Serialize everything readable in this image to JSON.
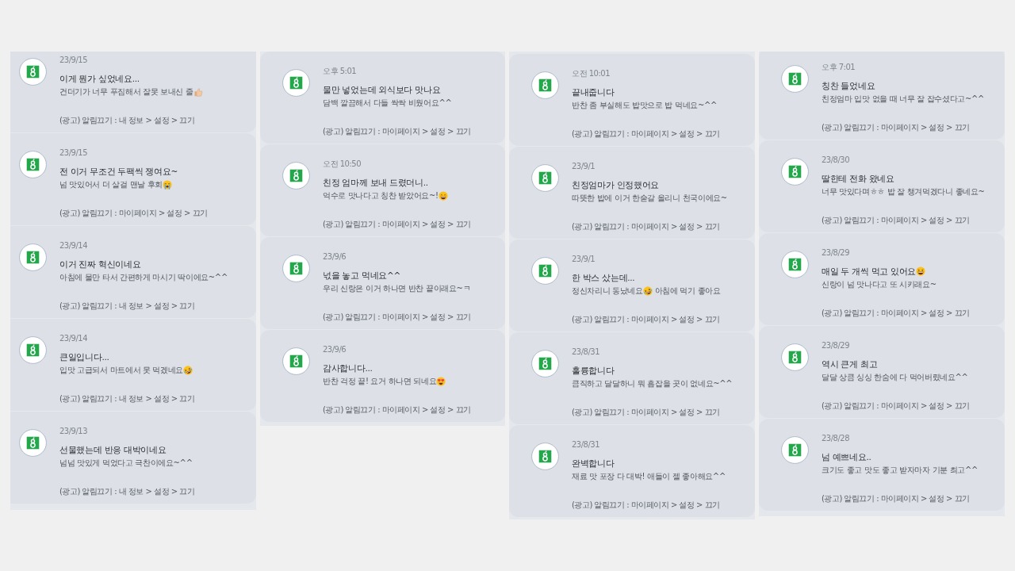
{
  "columns": [
    {
      "notifications": [
        {
          "time": "23/9/15",
          "title": [
            {
              "kind": "text",
              "text": "이게 뭔가 싶었네요..."
            }
          ],
          "body": [
            {
              "kind": "text",
              "text": "건더기가 너무 푸짐해서 잘못 보내신 줄"
            },
            {
              "kind": "thumbs-up"
            }
          ],
          "footer": "(광고) 알림끄기 : 내 정보 > 설정 > 끄기"
        },
        {
          "time": "23/9/15",
          "title": [
            {
              "kind": "text",
              "text": "전 이거 무조건 두팩씩 쟁여요~"
            }
          ],
          "body": [
            {
              "kind": "text",
              "text": "넘 맛있어서 더 살걸 맨날 후회"
            },
            {
              "kind": "crying"
            }
          ],
          "footer": "(광고) 알림끄기 : 마이페이지 > 설정 > 끄기"
        },
        {
          "time": "23/9/14",
          "title": [
            {
              "kind": "text",
              "text": "이거 진짜 혁신이네요"
            }
          ],
          "body": [
            {
              "kind": "text",
              "text": "아침에 물만 타서 간편하게 마시기 딱이에요~^^"
            }
          ],
          "footer": "(광고) 알림끄기 : 내 정보 > 설정 > 끄기"
        },
        {
          "time": "23/9/14",
          "title": [
            {
              "kind": "text",
              "text": "큰일입니다..."
            }
          ],
          "body": [
            {
              "kind": "text",
              "text": "입맛 고급되서 마트에서 못 먹겠네요"
            },
            {
              "kind": "rofl"
            }
          ],
          "footer": "(광고) 알림끄기 : 내 정보 > 설정 > 끄기"
        },
        {
          "time": "23/9/13",
          "title": [
            {
              "kind": "text",
              "text": "선물했는데 반응 대박이네요"
            }
          ],
          "body": [
            {
              "kind": "text",
              "text": "넘넘 맛있게 먹었다고 극찬이에요~^^"
            }
          ],
          "footer": "(광고) 알림끄기 : 내 정보 > 설정 > 끄기"
        }
      ]
    },
    {
      "notifications": [
        {
          "time": "오후 5:01",
          "title": [
            {
              "kind": "text",
              "text": "물만 넣었는데 외식보다 맛나요"
            }
          ],
          "body": [
            {
              "kind": "text",
              "text": "담백 깔끔해서 다들 싹싹 비웠어요^^"
            }
          ],
          "footer": "(광고) 알림끄기 : 마이페이지 > 설정 > 끄기"
        },
        {
          "time": "오전 10:50",
          "title": [
            {
              "kind": "text",
              "text": "친정 엄마께 보내 드렸더니.."
            }
          ],
          "body": [
            {
              "kind": "text",
              "text": "억수로 맛나다고 칭찬 받았어요~!"
            },
            {
              "kind": "grin"
            }
          ],
          "footer": "(광고) 알림끄기 : 마이페이지 > 설정 > 끄기"
        },
        {
          "time": "23/9/6",
          "title": [
            {
              "kind": "text",
              "text": "넋을 놓고 먹네요^^"
            }
          ],
          "body": [
            {
              "kind": "text",
              "text": "우리 신랑은 이거 하나면 반찬 끝이래요~ㅋ"
            }
          ],
          "footer": "(광고) 알림끄기 : 마이페이지 > 설정 > 끄기"
        },
        {
          "time": "23/9/6",
          "title": [
            {
              "kind": "text",
              "text": "감사합니다..."
            }
          ],
          "body": [
            {
              "kind": "text",
              "text": "반찬 걱정 끝! 요거 하나면 되네요"
            },
            {
              "kind": "heart-eyes"
            }
          ],
          "footer": "(광고) 알림끄기 : 마이페이지 > 설정 > 끄기"
        }
      ]
    },
    {
      "notifications": [
        {
          "time": "오전 10:01",
          "title": [
            {
              "kind": "text",
              "text": "끝내줍니다"
            }
          ],
          "body": [
            {
              "kind": "text",
              "text": "반찬 좀 부실해도 밥맛으로 밥 먹네요~^^"
            }
          ],
          "footer": "(광고) 알림끄기 : 마이페이지 > 설정 > 끄기"
        },
        {
          "time": "23/9/1",
          "title": [
            {
              "kind": "text",
              "text": "친정엄마가 인정했어요"
            }
          ],
          "body": [
            {
              "kind": "text",
              "text": "따뜻한 밥에 이거 한숟갈 올리니 천국이에요~"
            }
          ],
          "footer": "(광고) 알림끄기 : 마이페이지 > 설정 > 끄기"
        },
        {
          "time": "23/9/1",
          "title": [
            {
              "kind": "text",
              "text": "한 박스 샀는데..."
            }
          ],
          "body": [
            {
              "kind": "text",
              "text": "정신차리니 동났네요"
            },
            {
              "kind": "rofl"
            },
            {
              "kind": "text",
              "text": "아침에 먹기 좋아요"
            }
          ],
          "footer": "(광고) 알림끄기 : 마이페이지 > 설정 > 끄기"
        },
        {
          "time": "23/8/31",
          "title": [
            {
              "kind": "text",
              "text": "훌륭합니다"
            }
          ],
          "body": [
            {
              "kind": "text",
              "text": "큼직하고 달달하니 뭐 흠잡을 곳이 없네요~^^"
            }
          ],
          "footer": "(광고) 알림끄기 : 마이페이지 > 설정 > 끄기"
        },
        {
          "time": "23/8/31",
          "title": [
            {
              "kind": "text",
              "text": "완벽합니다"
            }
          ],
          "body": [
            {
              "kind": "text",
              "text": "재료 맛 포장 다 대박! 애들이 젤 좋아해요^^"
            }
          ],
          "footer": "(광고) 알림끄기 : 마이페이지 > 설정 > 끄기"
        }
      ]
    },
    {
      "notifications": [
        {
          "time": "오후 7:01",
          "title": [
            {
              "kind": "text",
              "text": "칭찬 들었네요"
            }
          ],
          "body": [
            {
              "kind": "text",
              "text": "친정엄마 입맛 없을 때 너무 잘 잡수셨다고~^^"
            }
          ],
          "footer": "(광고) 알림끄기 : 마이페이지 > 설정 > 끄기"
        },
        {
          "time": "23/8/30",
          "title": [
            {
              "kind": "text",
              "text": "딸한테 전화 왔네요"
            }
          ],
          "body": [
            {
              "kind": "text",
              "text": "너무 맛있다며ㅎㅎ 밥 잘 챙겨먹겠다니 좋네요~"
            }
          ],
          "footer": "(광고) 알림끄기 : 마이페이지 > 설정 > 끄기"
        },
        {
          "time": "23/8/29",
          "title": [
            {
              "kind": "text",
              "text": "매일 두 개씩 먹고 있어요"
            },
            {
              "kind": "laughing"
            }
          ],
          "body": [
            {
              "kind": "text",
              "text": "신랑이 넘 맛나다고 또 시키래요~"
            }
          ],
          "footer": "(광고) 알림끄기 : 마이페이지 > 설정 > 끄기"
        },
        {
          "time": "23/8/29",
          "title": [
            {
              "kind": "text",
              "text": "역시 큰게 최고"
            }
          ],
          "body": [
            {
              "kind": "text",
              "text": "달달 상큼 싱싱 한숨에 다 먹어버렸네요^^"
            }
          ],
          "footer": "(광고) 알림끄기 : 마이페이지 > 설정 > 끄기"
        },
        {
          "time": "23/8/28",
          "title": [
            {
              "kind": "text",
              "text": "넘 예쁘네요.."
            }
          ],
          "body": [
            {
              "kind": "text",
              "text": "크기도 좋고 맛도 좋고 받자마자 기분 최고^^"
            }
          ],
          "footer": "(광고) 알림끄기 : 마이페이지 > 설정 > 끄기"
        }
      ]
    }
  ]
}
